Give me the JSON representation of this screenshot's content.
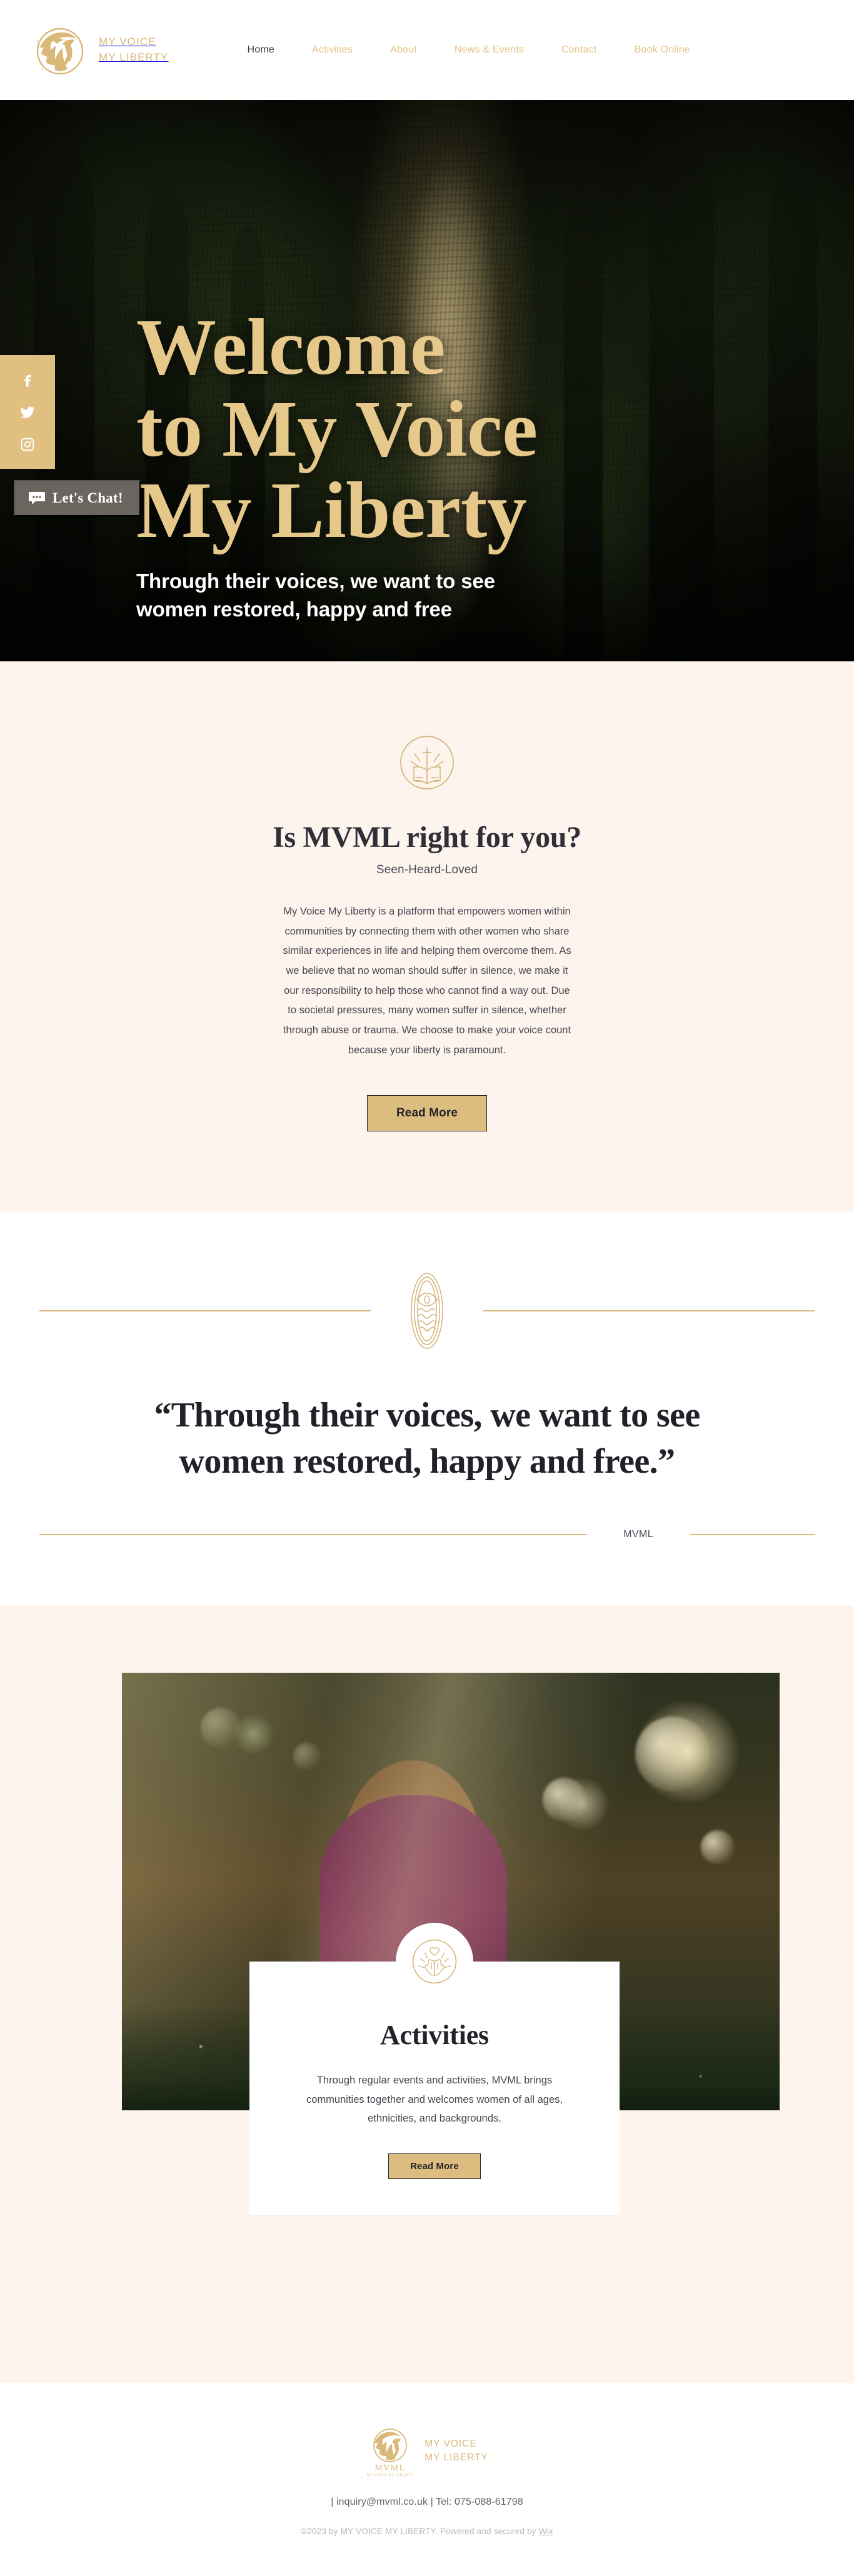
{
  "header": {
    "logo_line1": "MY VOICE",
    "logo_line2": "MY LIBERTY",
    "nav": [
      {
        "label": "Home",
        "active": true
      },
      {
        "label": "Activities",
        "active": false
      },
      {
        "label": "About",
        "active": false
      },
      {
        "label": "News & Events",
        "active": false
      },
      {
        "label": "Contact",
        "active": false
      },
      {
        "label": "Book Online",
        "active": false
      }
    ]
  },
  "hero": {
    "title_line1": "Welcome",
    "title_line2": "to My Voice",
    "title_line3": "My Liberty",
    "subtitle_line1": "Through their voices, we want to see",
    "subtitle_line2": "women restored, happy and free"
  },
  "social": {
    "facebook": "facebook-icon",
    "twitter": "twitter-icon",
    "instagram": "instagram-icon"
  },
  "chat": {
    "label": "Let's Chat!",
    "icon": "chat-bubble-icon"
  },
  "about": {
    "icon": "open-book-cross-crest-icon",
    "heading": "Is MVML right for you?",
    "tagline": "Seen-Heard-Loved",
    "body": "My Voice My Liberty is a platform that empowers women within communities by connecting them with other women who share similar experiences in life and helping them overcome them. As we believe that no woman should suffer in silence, we make it our responsibility to help those who cannot find a way out. Due to societal pressures, many women suffer in silence, whether through abuse or trauma. We choose to make your voice count because your liberty is paramount.",
    "button": "Read More"
  },
  "quote": {
    "ornament": "eye-oval-ornament-icon",
    "text": "“Through their voices, we want to see women restored, happy and free.”",
    "attribution": "MVML"
  },
  "activities": {
    "icon": "hands-heart-crest-icon",
    "title": "Activities",
    "body": "Through regular events and activities, MVML brings communities together and welcomes women of all ages, ethnicities, and backgrounds.",
    "button": "Read More"
  },
  "footer": {
    "logo_line1": "MY VOICE",
    "logo_line2": "MY LIBERTY",
    "logo_mark_text": "MVML",
    "logo_mark_sub": "MY VOICE MY LIBERTY",
    "contact": "|  inquiry@mvml.co.uk  |  Tel: 075-088-61798",
    "copyright_prefix": "©2023 by MY VOICE MY LIBERTY. Powered and secured by ",
    "copyright_link": "Wix"
  },
  "colors": {
    "gold": "#d9b878",
    "gold_solid": "#e0bf80",
    "button_gold": "#ddbd7f",
    "cream_bg": "#fdf4ee",
    "dark_text": "#2b2b33",
    "chat_gray": "#6b6560"
  }
}
